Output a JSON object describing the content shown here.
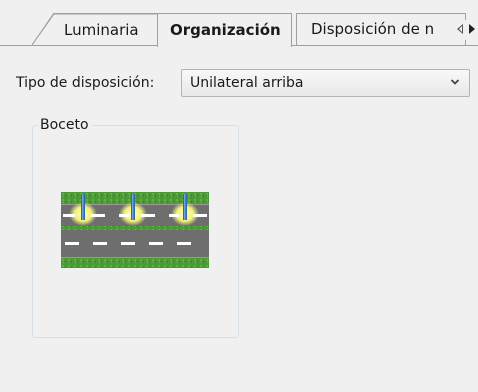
{
  "tabs": [
    {
      "label": "Luminaria",
      "active": false
    },
    {
      "label": "Organización",
      "active": true
    },
    {
      "label": "Disposición de n",
      "active": false
    }
  ],
  "tab_scroll": {
    "left_icon": "triangle-left-icon",
    "right_icon": "triangle-right-icon"
  },
  "layout_type": {
    "label": "Tipo de disposición:",
    "selected": "Unilateral arriba",
    "chevron_icon": "chevron-down-icon"
  },
  "sketch_group": {
    "title": "Boceto",
    "image_name": "road-layout-sketch"
  },
  "colors": {
    "panel_bg": "#f0f0f0",
    "grass": "#4c9a35",
    "asphalt": "#6e6e6e",
    "lamp_glow": "#f2f07a",
    "lamp_post": "#2f6aa6"
  }
}
